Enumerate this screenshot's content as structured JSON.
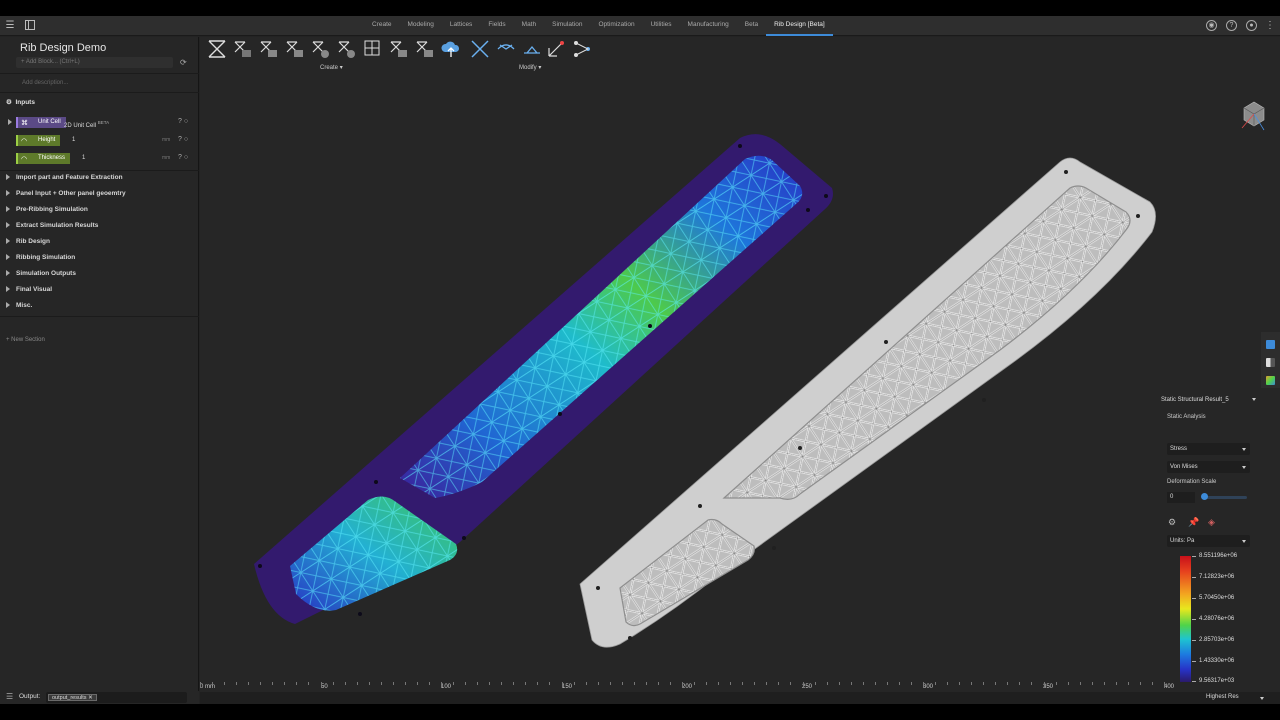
{
  "topbar": {
    "tabs": [
      {
        "label": "Create"
      },
      {
        "label": "Modeling"
      },
      {
        "label": "Lattices"
      },
      {
        "label": "Fields"
      },
      {
        "label": "Math"
      },
      {
        "label": "Simulation"
      },
      {
        "label": "Optimization"
      },
      {
        "label": "Utilities"
      },
      {
        "label": "Manufacturing"
      },
      {
        "label": "Beta"
      },
      {
        "label": "Rib Design [Beta]"
      }
    ],
    "active_tab": "Rib Design [Beta]"
  },
  "sidebar": {
    "title": "Rib Design Demo",
    "add_block_placeholder": "Add Block... (Ctrl+L)",
    "description_placeholder": "Add description...",
    "inputs_header": "Inputs",
    "inputs": [
      {
        "name": "Unit Cell",
        "value": "2D Unit Cell",
        "badge": "BETA",
        "unit": ""
      },
      {
        "name": "Height",
        "value": "1",
        "unit": "mm"
      },
      {
        "name": "Thickness",
        "value": "1",
        "unit": "mm"
      }
    ],
    "sections": [
      "Import part and Feature Extraction",
      "Panel Input + Other panel geoemtry",
      "Pre-Ribbing Simulation",
      "Extract Simulation Results",
      "Rib Design",
      "Ribbing Simulation",
      "Simulation Outputs",
      "Final Visual",
      "Misc."
    ],
    "new_section": "New Section",
    "output_label": "Output:",
    "output_value": "output_results"
  },
  "toolbar": {
    "create_label": "Create",
    "modify_label": "Modify"
  },
  "results": {
    "title": "Static Structural Result_5",
    "analysis": "Static Analysis",
    "quantity": "Stress",
    "component": "Von Mises",
    "deformation_label": "Deformation Scale",
    "deformation_value": "0",
    "units": "Units: Pa",
    "legend": [
      "8.551196e+06",
      "7.12823e+06",
      "5.70450e+06",
      "4.28076e+06",
      "2.85703e+06",
      "1.43330e+06",
      "9.56317e+03"
    ]
  },
  "ruler": {
    "labels": [
      "0 mm",
      "50",
      "100",
      "150",
      "200",
      "250",
      "300",
      "350",
      "400"
    ]
  },
  "status": {
    "quality": "Highest Res"
  },
  "colors": {
    "accent": "#3d8bd9",
    "unit_cell_chip": "#5b4a86",
    "param_chip": "#5e7a2a"
  }
}
